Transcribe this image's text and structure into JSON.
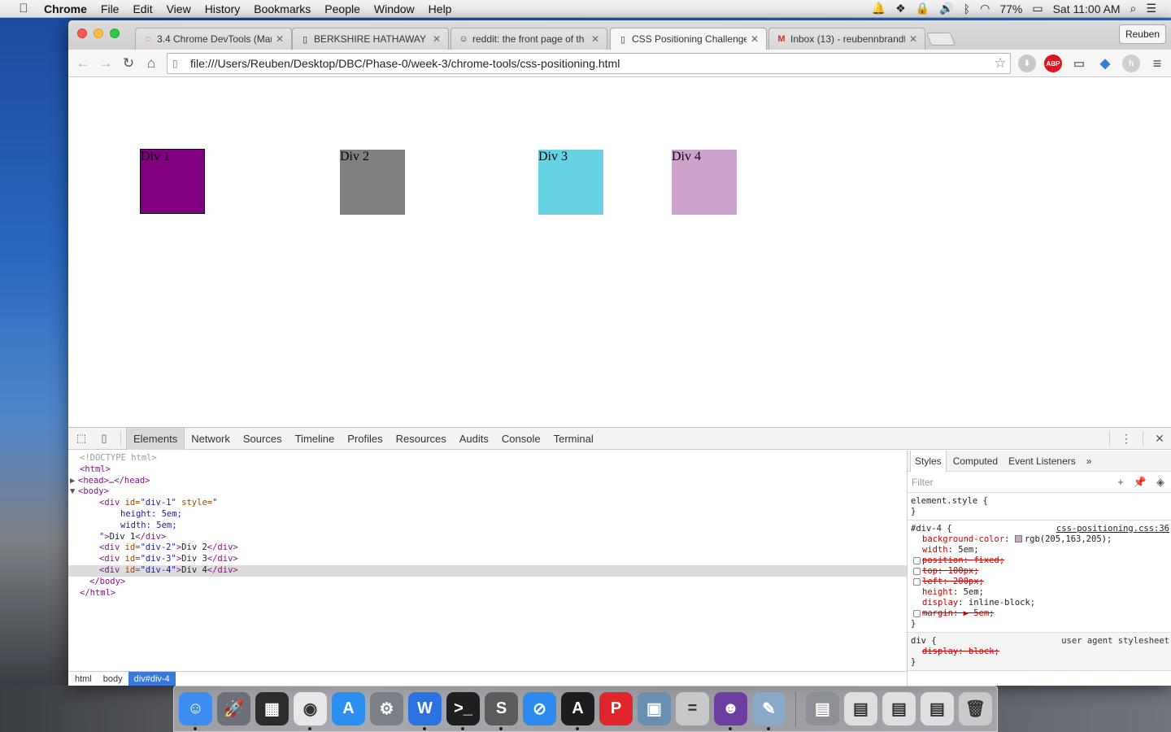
{
  "menubar": {
    "app_name": "Chrome",
    "items": [
      "File",
      "Edit",
      "View",
      "History",
      "Bookmarks",
      "People",
      "Window",
      "Help"
    ],
    "battery": "77%",
    "clock": "Sat 11:00 AM"
  },
  "tabs": [
    {
      "label": "3.4 Chrome DevTools (Man",
      "icon": "devbootcamp-icon"
    },
    {
      "label": "BERKSHIRE HATHAWAY IN",
      "icon": "page-icon"
    },
    {
      "label": "reddit: the front page of th",
      "icon": "reddit-icon"
    },
    {
      "label": "CSS Positioning Challenge",
      "icon": "page-icon",
      "active": true
    },
    {
      "label": "Inbox (13) - reubennbrandt",
      "icon": "gmail-icon"
    }
  ],
  "profile_name": "Reuben",
  "address_bar": {
    "url": "file:///Users/Reuben/Desktop/DBC/Phase-0/week-3/chrome-tools/css-positioning.html"
  },
  "page": {
    "divs": [
      {
        "label": "Div 1",
        "color": "#800080"
      },
      {
        "label": "Div 2",
        "color": "#808080"
      },
      {
        "label": "Div 3",
        "color": "#66d2e4"
      },
      {
        "label": "Div 4",
        "color": "#cda3cd"
      }
    ]
  },
  "devtools": {
    "tabs": [
      "Elements",
      "Network",
      "Sources",
      "Timeline",
      "Profiles",
      "Resources",
      "Audits",
      "Console",
      "Terminal"
    ],
    "active_tab": "Elements",
    "dom_lines": {
      "l1": "<!DOCTYPE html>",
      "l2_tag": "<html>",
      "l3_tag": "<head>…</head>",
      "l4_tag": "<body>",
      "l5_open": "<div ",
      "l5_attr": "id=",
      "l5_val": "\"div-1\"",
      "l5_attr2": " style=",
      "l5_val2": "\"",
      "l6": "height: 5em;",
      "l7": "width: 5em;",
      "l8_val": "\"",
      "l8_tag": ">",
      "l8_text": "Div 1",
      "l8_close": "</div>",
      "l9_val": "\"div-2\"",
      "l9_text": "Div 2",
      "l10_val": "\"div-3\"",
      "l10_text": "Div 3",
      "l11_val": "\"div-4\"",
      "l11_text": "Div 4",
      "l12": "</body>",
      "l13": "</html>"
    },
    "breadcrumbs": [
      "html",
      "body",
      "div#div-4"
    ],
    "styles": {
      "tabs": [
        "Styles",
        "Computed",
        "Event Listeners",
        "»"
      ],
      "filter_placeholder": "Filter",
      "element_style": "element.style {",
      "close_brace": "}",
      "rule_selector": "#div-4 {",
      "rule_source": "css-positioning.css:36",
      "props": [
        {
          "name": "background-color",
          "value": "rgb(205,163,205);",
          "struck": false,
          "checkbox": false,
          "swatch": "#cda3cd"
        },
        {
          "name": "width",
          "value": "5em;",
          "struck": false,
          "checkbox": false
        },
        {
          "name": "position",
          "value": "fixed;",
          "struck": true,
          "checkbox": true
        },
        {
          "name": "top",
          "value": "100px;",
          "struck": true,
          "checkbox": true
        },
        {
          "name": "left",
          "value": "200px;",
          "struck": true,
          "checkbox": true
        },
        {
          "name": "height",
          "value": "5em;",
          "struck": false,
          "checkbox": false
        },
        {
          "name": "display",
          "value": "inline-block;",
          "struck": false,
          "checkbox": false
        },
        {
          "name": "margin",
          "value": "▶ 5em;",
          "struck": true,
          "checkbox": true
        }
      ],
      "ua_selector": "div {",
      "ua_source": "user agent stylesheet",
      "ua_prop_name": "display",
      "ua_prop_value": "block;"
    }
  },
  "dock_apps": [
    {
      "name": "finder",
      "color": "#3e8ef0",
      "glyph": "☺"
    },
    {
      "name": "launchpad",
      "color": "#6c6f78",
      "glyph": "🚀"
    },
    {
      "name": "photo-booth",
      "color": "#2c2c2c",
      "glyph": "▦"
    },
    {
      "name": "chrome",
      "color": "#e8e8e8",
      "glyph": "◉"
    },
    {
      "name": "app-store",
      "color": "#2a8ff1",
      "glyph": "A"
    },
    {
      "name": "system-preferences",
      "color": "#7b7f88",
      "glyph": "⚙"
    },
    {
      "name": "word",
      "color": "#2b72e0",
      "glyph": "W"
    },
    {
      "name": "terminal",
      "color": "#1f1f1f",
      "glyph": ">_"
    },
    {
      "name": "sublime-text",
      "color": "#5b5b5b",
      "glyph": "S"
    },
    {
      "name": "safari",
      "color": "#2d8af0",
      "glyph": "⊘"
    },
    {
      "name": "acrobat",
      "color": "#1d1d1d",
      "glyph": "A"
    },
    {
      "name": "pdf-expert",
      "color": "#e0262a",
      "glyph": "P"
    },
    {
      "name": "image-capture",
      "color": "#6a8fb0",
      "glyph": "▣"
    },
    {
      "name": "calculator",
      "color": "#c8c8c8",
      "glyph": "="
    },
    {
      "name": "github",
      "color": "#6b3ea0",
      "glyph": "☻"
    },
    {
      "name": "preview",
      "color": "#8aa9c8",
      "glyph": "✎"
    },
    {
      "name": "documents-stack",
      "color": "#8c8f96",
      "glyph": "▤"
    },
    {
      "name": "word-doc",
      "color": "#dedede",
      "glyph": "▤"
    },
    {
      "name": "chrome-doc",
      "color": "#dedede",
      "glyph": "▤"
    },
    {
      "name": "chrome-doc-2",
      "color": "#dedede",
      "glyph": "▤"
    },
    {
      "name": "trash",
      "color": "#c9c9c9",
      "glyph": "🗑"
    }
  ]
}
